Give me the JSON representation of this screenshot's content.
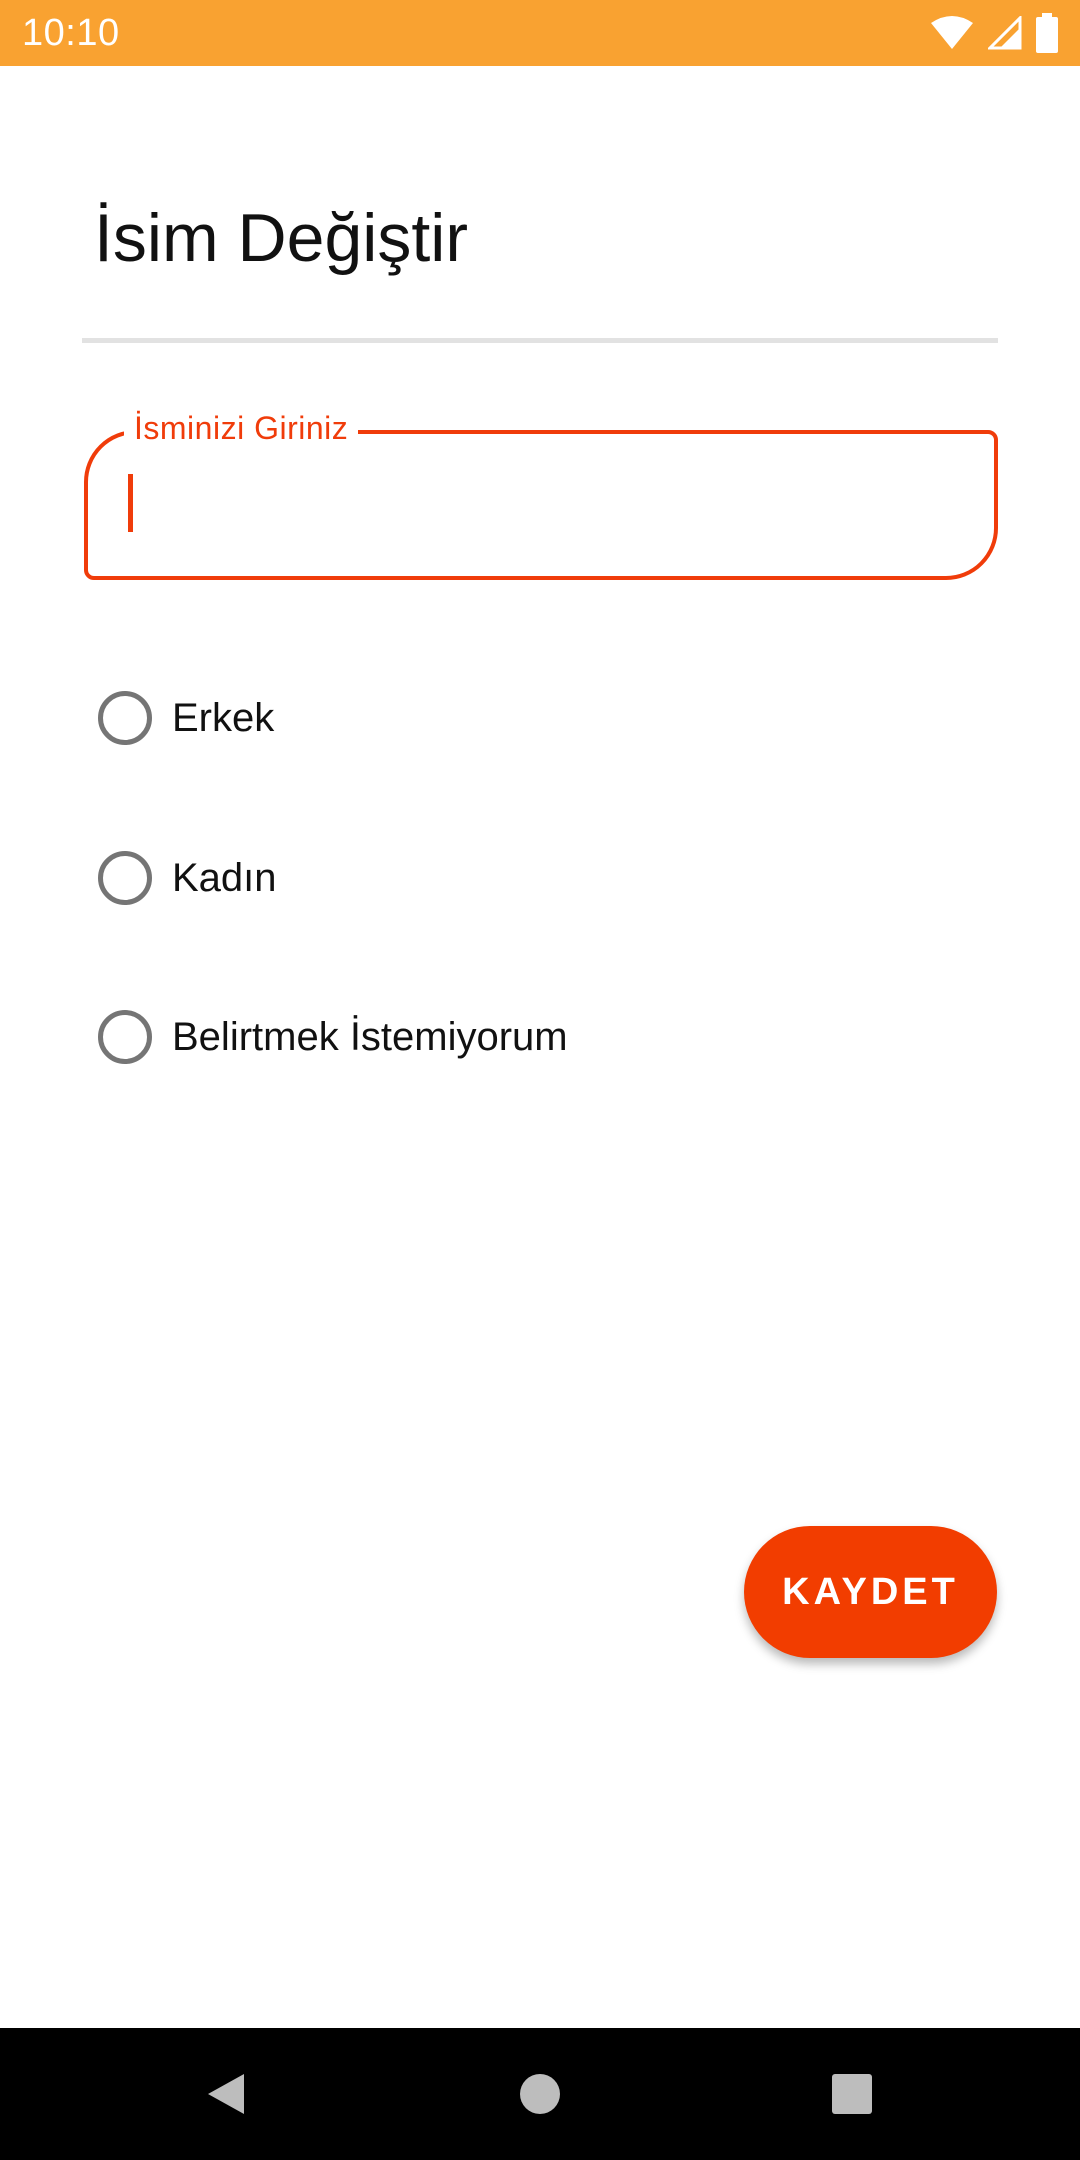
{
  "status_bar": {
    "time": "10:10",
    "icons": [
      "wifi-icon",
      "cellular-signal-icon",
      "battery-icon"
    ],
    "background": "#F9A231"
  },
  "page": {
    "title": "İsim Değiştir"
  },
  "name_field": {
    "label": "İsminizi Giriniz",
    "value": "",
    "accent": "#F03C0A"
  },
  "gender_options": [
    {
      "label": "Erkek",
      "selected": false
    },
    {
      "label": "Kadın",
      "selected": false
    },
    {
      "label": "Belirtmek İstemiyorum",
      "selected": false
    }
  ],
  "save_button": {
    "label": "KAYDET",
    "color": "#F23D00"
  },
  "nav_bar": {
    "icons": [
      "back-icon",
      "home-icon",
      "recents-icon"
    ]
  }
}
